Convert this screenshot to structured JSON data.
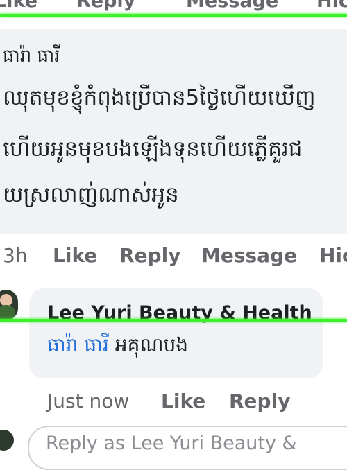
{
  "top_actions": {
    "like": "Like",
    "reply": "Reply",
    "message": "Message",
    "hide": "Hic"
  },
  "comment": {
    "author": "ធារ៉ា ធារី",
    "lines": [
      "ឈុតមុខខ្ញុំកំពុងប្រើបាន5ថ្ងៃហើយឃើញ",
      "ហើយអូនមុខបងឡើងទុនហើយភ្លើគួរជ",
      "យស្រលាញ់ណាស់អូន"
    ],
    "time": "3h",
    "like": "Like",
    "reply": "Reply",
    "message": "Message",
    "hide": "Hic"
  },
  "reply": {
    "author": "Lee Yuri Beauty & Health",
    "mention": "ធារ៉ា ធារី",
    "text": "អគុណបង",
    "time": "Just now",
    "like": "Like",
    "reply": "Reply"
  },
  "composer": {
    "placeholder": "Reply as Lee Yuri Beauty &"
  },
  "colors": {
    "highlight": "#3cf02a",
    "bubble": "#f0f2f5",
    "link": "#216fdb",
    "meta": "#65676b"
  }
}
